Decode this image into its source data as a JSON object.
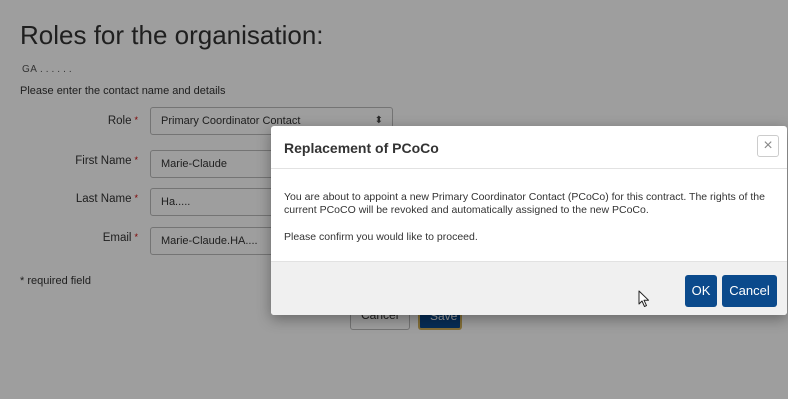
{
  "page": {
    "title": "Roles for the organisation:",
    "organisation_name": "GA . . . . . .",
    "intro": "Please enter the contact name and details",
    "required_note": "* required field"
  },
  "form": {
    "role": {
      "label": "Role",
      "value": "Primary Coordinator Contact"
    },
    "first_name": {
      "label": "First Name",
      "value": "Marie-Claude"
    },
    "last_name": {
      "label": "Last Name",
      "value": "Ha....."
    },
    "email": {
      "label": "Email",
      "value": "Marie-Claude.HA...."
    },
    "required_marker": "*",
    "select_arrow": "⬍",
    "cancel_label": "Cancel",
    "save_label": "Save"
  },
  "modal": {
    "title": "Replacement of PCoCo",
    "close_symbol": "×",
    "message": "You are about to appoint a new Primary Coordinator Contact (PCoCo) for this contract. The rights of the current PCoCO will be revoked and automatically assigned to the new PCoCo.",
    "confirm": "Please confirm you would like to proceed.",
    "ok_label": "OK",
    "cancel_label": "Cancel"
  },
  "colors": {
    "primary_button": "#0b4a8c",
    "required_marker": "#cc0000",
    "overlay": "rgba(0,0,0,0.38)"
  },
  "icons": {
    "cursor": "mouse-pointer-icon",
    "close": "close-icon",
    "dropdown": "select-arrows-icon"
  }
}
